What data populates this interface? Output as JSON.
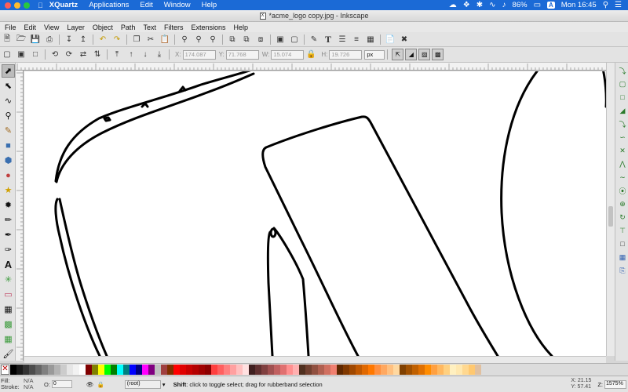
{
  "menubar": {
    "app": "XQuartz",
    "items": [
      "Applications",
      "Edit",
      "Window",
      "Help"
    ],
    "battery": "86%",
    "input_badge": "A",
    "clock": "Mon 16:45"
  },
  "window": {
    "title": "*acme_logo copy.jpg - Inkscape"
  },
  "app_menu": [
    "File",
    "Edit",
    "View",
    "Layer",
    "Object",
    "Path",
    "Text",
    "Filters",
    "Extensions",
    "Help"
  ],
  "ctrl_bar": {
    "x_label": "X:",
    "x_value": "174.087",
    "y_label": "Y:",
    "y_value": "71.768",
    "w_label": "W:",
    "w_value": "15.074",
    "h_label": "H:",
    "h_value": "19.726",
    "unit": "px"
  },
  "status": {
    "fill_label": "Fill:",
    "fill_value": "N/A",
    "stroke_label": "Stroke:",
    "stroke_value": "N/A",
    "opacity_label": "O:",
    "opacity_value": "0",
    "layer": "(root)",
    "message_key": "Shift",
    "message_rest": ": click to toggle select; drag for rubberband selection",
    "coord_x": "X: 21.15",
    "coord_y": "Y: 57.41",
    "zoom": "1575%"
  },
  "colors": {
    "menubar_bg": "#1b6ad6",
    "close": "#fe5f57",
    "minimize": "#febc2e",
    "zoom": "#28c840"
  },
  "palette": [
    "#000000",
    "#1a1a1a",
    "#333333",
    "#4d4d4d",
    "#666666",
    "#808080",
    "#999999",
    "#b3b3b3",
    "#cccccc",
    "#e6e6e6",
    "#f2f2f2",
    "#ffffff",
    "#800000",
    "#808000",
    "#ffff00",
    "#00ff00",
    "#008000",
    "#00ffff",
    "#008080",
    "#0000ff",
    "#000080",
    "#ff00ff",
    "#800080",
    "#c0c0c0",
    "#a04040",
    "#803000",
    "#ff0000",
    "#e00000",
    "#c80000",
    "#b40000",
    "#a00000",
    "#8c0000",
    "#ff4040",
    "#ff6060",
    "#ff8080",
    "#ffa0a0",
    "#ffc0c0",
    "#ffe0e0",
    "#402020",
    "#603030",
    "#804040",
    "#a05050",
    "#c06060",
    "#e07070",
    "#ff9090",
    "#ffb0b0",
    "#503020",
    "#704030",
    "#905040",
    "#b06050",
    "#d07060",
    "#f08070",
    "#602800",
    "#803800",
    "#a04800",
    "#c05800",
    "#e06800",
    "#ff7800",
    "#ff9040",
    "#ffa860",
    "#ffc080",
    "#ffd8a0",
    "#804000",
    "#a05000",
    "#c06000",
    "#e07000",
    "#ff8c00",
    "#ffa040",
    "#ffb860",
    "#ffd080",
    "#fff0c0",
    "#ffe8b0",
    "#ffd890",
    "#ffc870",
    "#e0c0a0"
  ],
  "tools": [
    "selector-tool",
    "node-tool",
    "tweak-tool",
    "zoom-tool",
    "measure-tool",
    "rect-tool",
    "3dbox-tool",
    "ellipse-tool",
    "star-tool",
    "spiral-tool",
    "pencil-tool",
    "pen-tool",
    "calligraphy-tool",
    "text-tool",
    "spray-tool",
    "eraser-tool",
    "bucket-tool",
    "gradient-tool",
    "mesh-tool",
    "dropper-tool"
  ]
}
